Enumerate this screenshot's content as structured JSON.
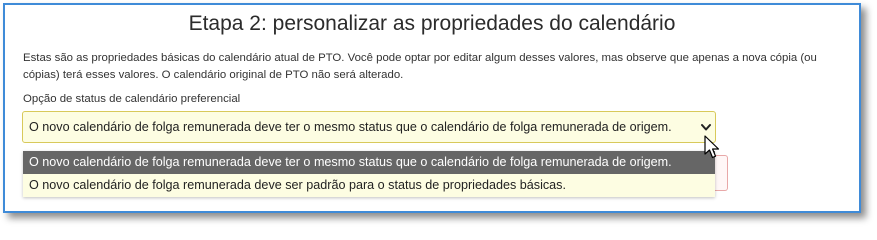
{
  "dialog": {
    "title": "Etapa 2: personalizar as propriedades do calendário",
    "description": "Estas são as propriedades básicas do calendário atual de PTO. Você pode optar por editar algum desses valores, mas observe que apenas a nova cópia (ou cópias) terá esses valores. O calendário original de PTO não será alterado.",
    "status_field": {
      "label": "Opção de status de calendário preferencial",
      "selected_value": "O novo calendário de folga remunerada deve ter o mesmo status que o calendário de folga remunerada de origem.",
      "expanded": true,
      "options": [
        {
          "label": "O novo calendário de folga remunerada deve ter o mesmo status que o calendário de folga remunerada de origem.",
          "highlighted": true
        },
        {
          "label": "O novo calendário de folga remunerada deve ser padrão para o status de propriedades básicas.",
          "highlighted": false
        }
      ]
    }
  },
  "icons": {
    "dropdown_arrow": "chevron-down-icon",
    "pointer": "mouse-cursor-icon"
  },
  "colors": {
    "border_accent": "#3f8bd8",
    "field_background": "#fdfde2",
    "field_border": "#d8c95a",
    "highlight_background": "#666666",
    "highlight_text": "#ffffff"
  }
}
